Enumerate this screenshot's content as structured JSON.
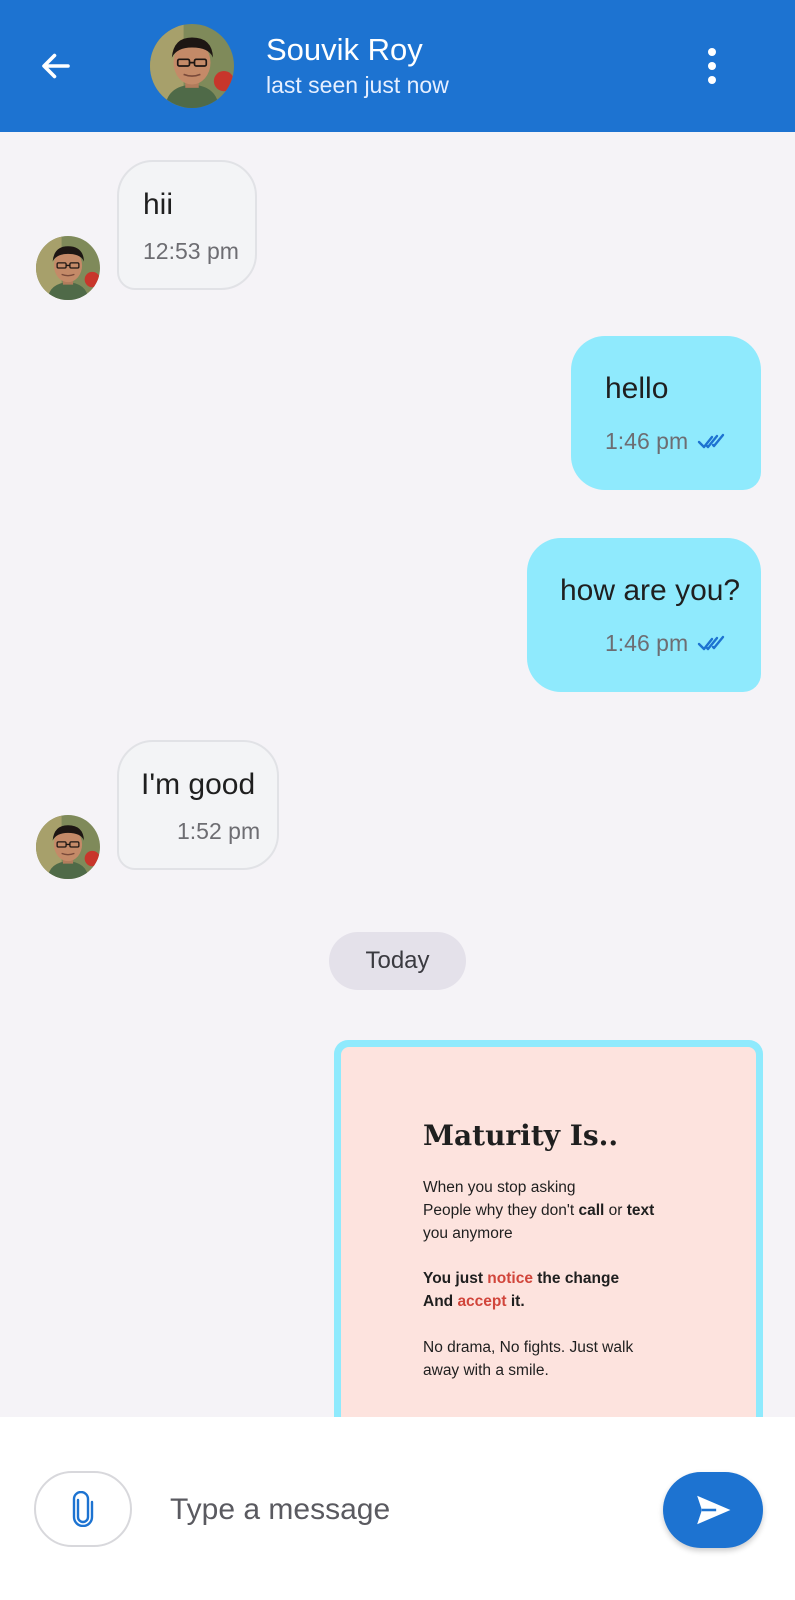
{
  "header": {
    "back_icon": "arrow-left-icon",
    "contact_name": "Souvik Roy",
    "contact_status": "last seen just now",
    "menu_icon": "more-vertical-icon",
    "color": "#1d73d1"
  },
  "messages": [
    {
      "direction": "incoming",
      "text": "hii",
      "time": "12:53 pm"
    },
    {
      "direction": "outgoing",
      "text": "hello",
      "time": "1:46 pm",
      "status_icon": "double-check-icon"
    },
    {
      "direction": "outgoing",
      "text": "how are you?",
      "time": "1:46 pm",
      "status_icon": "double-check-icon"
    },
    {
      "direction": "incoming",
      "text": "I'm good",
      "time": "1:52 pm"
    }
  ],
  "date_separator": "Today",
  "image_message": {
    "direction": "outgoing",
    "title": "Maturity Is..",
    "line1": "When you stop asking",
    "line2_a": "People why they don't ",
    "line2_b": "call",
    "line2_c": " or ",
    "line2_d": "text",
    "line3": "you anymore",
    "line4_a": "You just ",
    "line4_b": "notice",
    "line4_c": " the change",
    "line5_a": "And ",
    "line5_b": "accept",
    "line5_c": " it.",
    "line6": "No drama, No fights. Just walk",
    "line7": "away with a smile."
  },
  "composer": {
    "attach_icon": "paperclip-icon",
    "placeholder": "Type a message",
    "value": "",
    "send_icon": "send-icon"
  },
  "colors": {
    "accent": "#1d73d1",
    "outgoing_bubble": "#8feafd",
    "incoming_bubble": "#f3f4f6",
    "background": "#f5f3f7",
    "read_tick": "#1d73d1"
  }
}
